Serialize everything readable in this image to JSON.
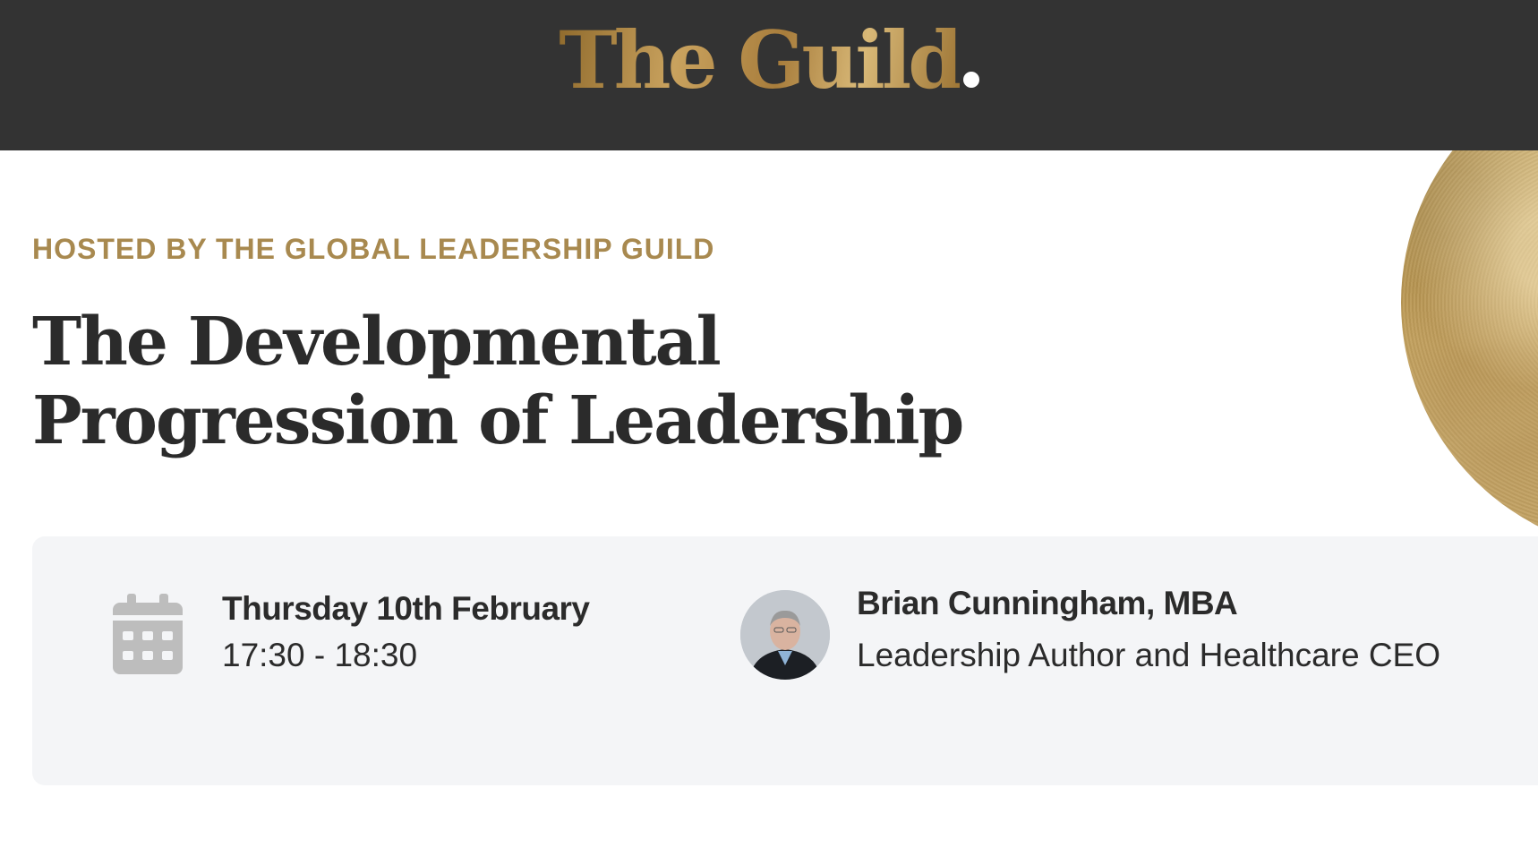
{
  "header": {
    "logo_text": "The Guild",
    "logo_icon": "guild-logo"
  },
  "event": {
    "hosted_by": "HOSTED BY THE GLOBAL LEADERSHIP GUILD",
    "title_line1": "The Developmental",
    "title_line2": "Progression of Leadership"
  },
  "details": {
    "date_icon": "calendar-icon",
    "date": "Thursday 10th February",
    "time": "17:30 - 18:30"
  },
  "speaker": {
    "name": "Brian Cunningham, MBA",
    "role": "Leadership Author and Healthcare CEO"
  },
  "colors": {
    "header_bg": "#333333",
    "accent_gold": "#a8894f",
    "text_dark": "#2b2b2b",
    "card_bg": "#f4f5f7"
  }
}
